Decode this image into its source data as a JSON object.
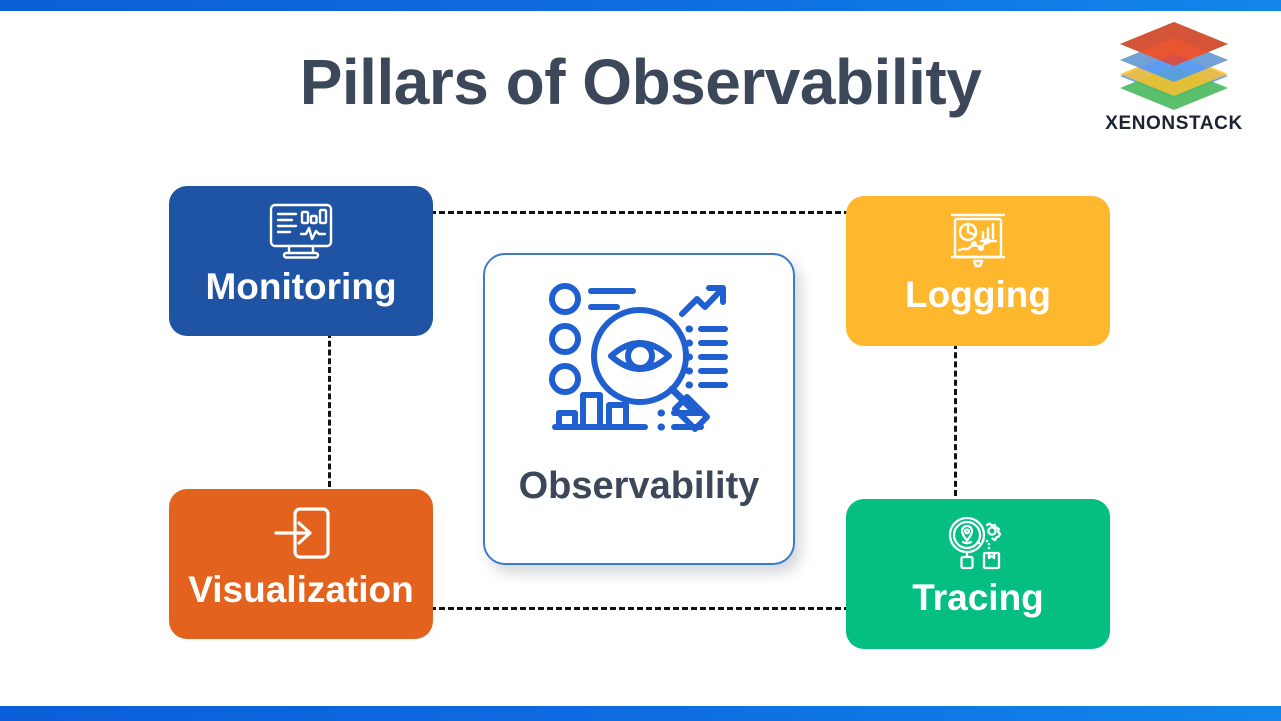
{
  "slide": {
    "title": "Pillars of Observability",
    "accent_bar_color": "#0e6ae0",
    "title_color": "#3c4759",
    "background_color": "#ffffff"
  },
  "brand": {
    "name": "XENONSTACK",
    "logo_icon": "stacked-layers-logo-icon",
    "layer_colors": [
      "#e8412d",
      "#5b9bf0",
      "#fcc131",
      "#4cbb62"
    ]
  },
  "center": {
    "label": "Observability",
    "icon": "magnifier-eye-analytics-icon",
    "icon_color": "#1f5fd0",
    "border_color": "#3d7cc9",
    "label_color": "#3c4759"
  },
  "pillars": [
    {
      "key": "monitoring",
      "label": "Monitoring",
      "icon": "monitor-dashboard-icon",
      "color": "#1F53A4",
      "position": "top-left"
    },
    {
      "key": "logging",
      "label": "Logging",
      "icon": "presentation-charts-icon",
      "color": "#FFB72E",
      "position": "top-right"
    },
    {
      "key": "visualization",
      "label": "Visualization",
      "icon": "arrow-into-box-icon",
      "color": "#E3621E",
      "position": "bottom-left"
    },
    {
      "key": "tracing",
      "label": "Tracing",
      "icon": "magnifier-location-package-icon",
      "color": "#04BE82",
      "position": "bottom-right"
    }
  ],
  "connectors": [
    {
      "name": "monitoring-to-logging",
      "orientation": "horizontal",
      "style": "dashed",
      "color": "#121212"
    },
    {
      "name": "visualization-to-tracing",
      "orientation": "horizontal",
      "style": "dashed",
      "color": "#121212"
    },
    {
      "name": "monitoring-to-visualization",
      "orientation": "vertical",
      "style": "dashed",
      "color": "#121212"
    },
    {
      "name": "logging-to-tracing",
      "orientation": "vertical",
      "style": "dashed",
      "color": "#121212"
    }
  ]
}
